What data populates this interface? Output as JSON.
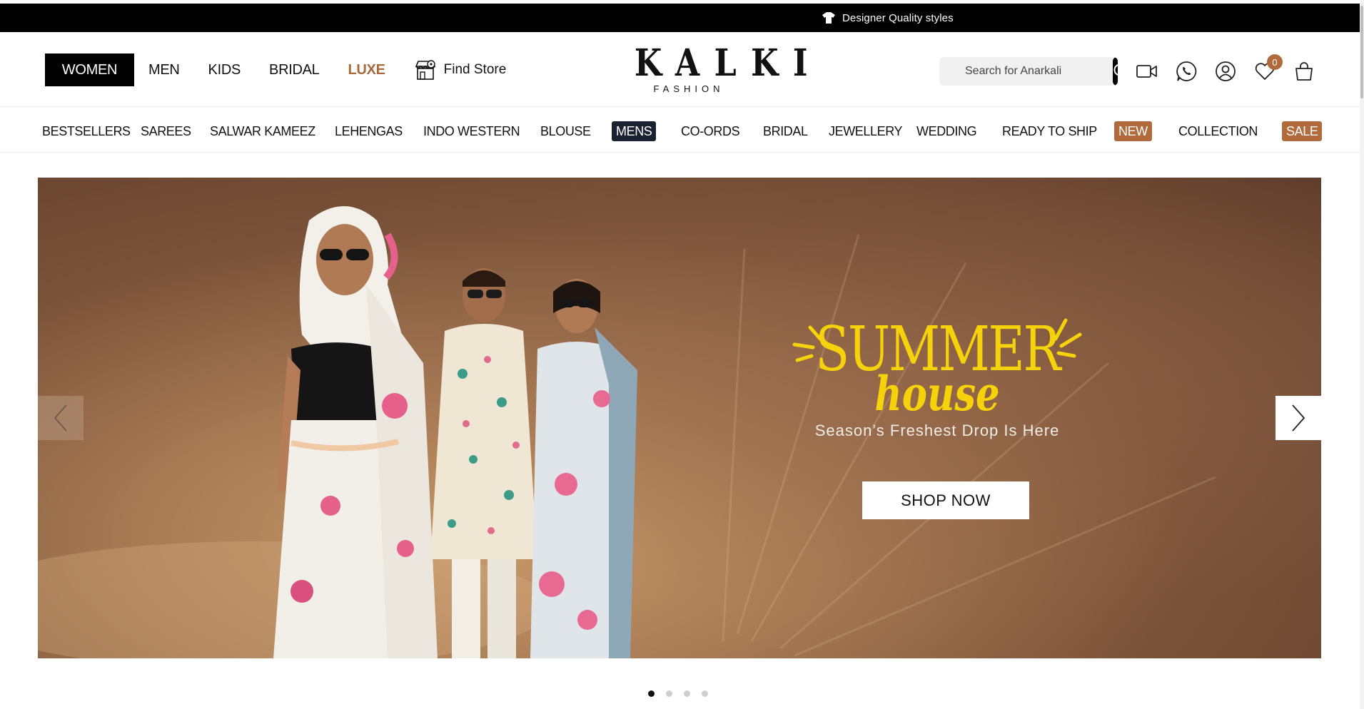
{
  "announcement": {
    "text": "Designer Quality styles"
  },
  "topnav": {
    "items": [
      {
        "label": "WOMEN",
        "active": true
      },
      {
        "label": "MEN"
      },
      {
        "label": "KIDS"
      },
      {
        "label": "BRIDAL"
      },
      {
        "label": "LUXE",
        "accent": "#a86a3c"
      }
    ],
    "find_store": "Find Store"
  },
  "logo": {
    "brand": "KALKI",
    "sub": "FASHION"
  },
  "search": {
    "placeholder": "Search for Anarkali"
  },
  "header_icons": {
    "icons": [
      "video-call-icon",
      "whatsapp-icon",
      "account-icon",
      "wishlist-icon",
      "cart-icon"
    ],
    "wishlist_count": "0"
  },
  "catnav": {
    "items": [
      {
        "label": "BESTSELLERS"
      },
      {
        "label": "SAREES"
      },
      {
        "label": "SALWAR KAMEEZ"
      },
      {
        "label": "LEHENGAS"
      },
      {
        "label": "INDO WESTERN"
      },
      {
        "label": "BLOUSE"
      },
      {
        "label": "MENS",
        "highlight": "#1a2130"
      },
      {
        "label": "CO-ORDS"
      },
      {
        "label": "BRIDAL"
      },
      {
        "label": "JEWELLERY"
      },
      {
        "label": "WEDDING"
      },
      {
        "label": "READY TO SHIP"
      },
      {
        "label": "NEW",
        "highlight": "#b06a3b"
      },
      {
        "label": "COLLECTION"
      },
      {
        "label": "SALE",
        "highlight": "#b06a3b"
      }
    ]
  },
  "hero": {
    "headline": "SUMMER",
    "headline_script": "house",
    "tagline": "Season’s Freshest Drop Is Here",
    "cta": "SHOP NOW",
    "accent": "#f5d20a",
    "slides_total": 4,
    "active_slide": 1
  },
  "colors": {
    "brand_brown": "#b06a3b",
    "navy": "#1a2130",
    "black": "#000000"
  }
}
